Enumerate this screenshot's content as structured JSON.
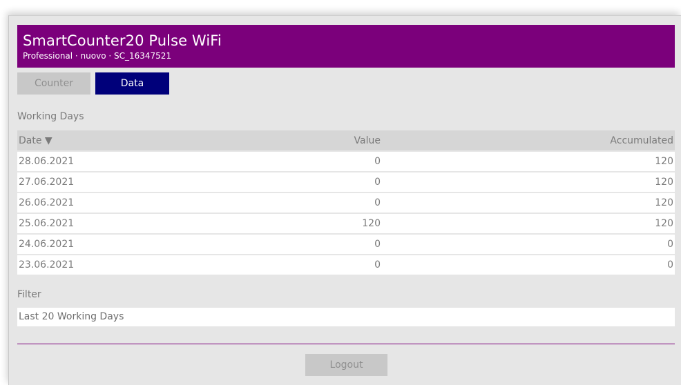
{
  "header": {
    "title": "SmartCounter20 Pulse WiFi",
    "subtitle": "Professional · nuovo · SC_16347521"
  },
  "tabs": [
    {
      "label": "Counter",
      "active": false
    },
    {
      "label": "Data",
      "active": true
    }
  ],
  "working_days": {
    "label": "Working Days",
    "columns": {
      "date": "Date ▼",
      "value": "Value",
      "accumulated": "Accumulated"
    },
    "rows": [
      {
        "date": "28.06.2021",
        "value": "0",
        "accumulated": "120"
      },
      {
        "date": "27.06.2021",
        "value": "0",
        "accumulated": "120"
      },
      {
        "date": "26.06.2021",
        "value": "0",
        "accumulated": "120"
      },
      {
        "date": "25.06.2021",
        "value": "120",
        "accumulated": "120"
      },
      {
        "date": "24.06.2021",
        "value": "0",
        "accumulated": "0"
      },
      {
        "date": "23.06.2021",
        "value": "0",
        "accumulated": "0"
      }
    ]
  },
  "filter": {
    "label": "Filter",
    "value": "Last 20 Working Days"
  },
  "footer": {
    "logout_label": "Logout"
  },
  "colors": {
    "brand": "#7b007b",
    "active_tab": "#00007a",
    "panel_bg": "#e6e6e6",
    "muted_text": "#7a7a7a"
  }
}
